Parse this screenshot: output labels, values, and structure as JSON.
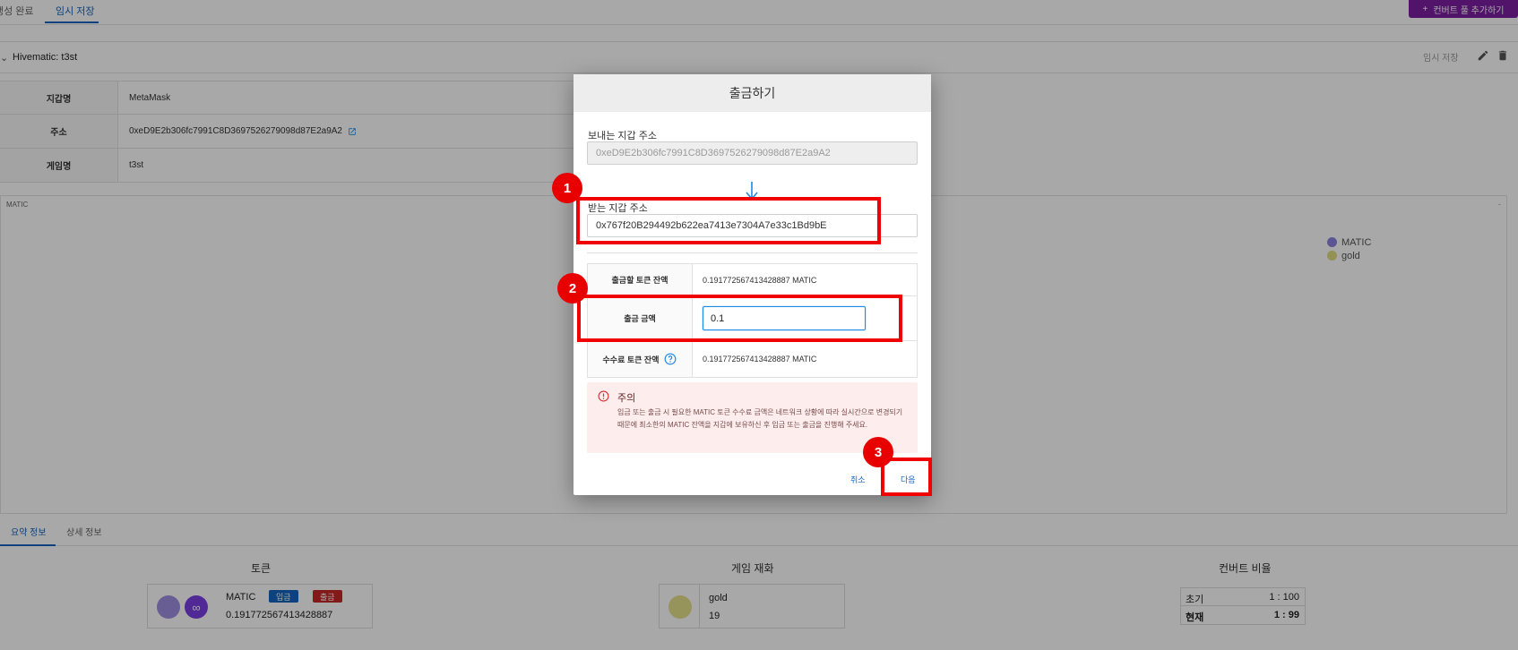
{
  "top_tabs": {
    "tab1": "생성 완료",
    "tab2": "임시 저장"
  },
  "add_pool_button": {
    "icon": "plus-icon",
    "label": "컨버트 풀 추가하기",
    "color": "#7b1fa2"
  },
  "section": {
    "title": "Hivematic: t3st",
    "temp_save": "임시 저장"
  },
  "info_rows": [
    {
      "label": "지갑명",
      "value": "MetaMask"
    },
    {
      "label": "주소",
      "value": "0xeD9E2b306fc7991C8D3697526279098d87E2a9A2"
    },
    {
      "label": "게임명",
      "value": "t3st"
    }
  ],
  "chart": {
    "label": "MATIC",
    "legend": [
      {
        "name": "MATIC",
        "color": "#8e80e0"
      },
      {
        "name": "gold",
        "color": "#e0dc80"
      }
    ]
  },
  "summary_tabs": {
    "tab1": "요약 정보",
    "tab2": "상세 정보"
  },
  "summary": {
    "token_head": "토큰",
    "asset_head": "게임 재화",
    "ratio_head": "컨버트 비율",
    "token": {
      "name": "MATIC",
      "deposit": "입금",
      "withdraw": "출금",
      "balance": "0.191772567413428887"
    },
    "asset": {
      "name": "gold",
      "value": "19"
    },
    "ratio": [
      {
        "label": "초기",
        "value": "1 : 100"
      },
      {
        "label": "현재",
        "value": "1 : 99"
      }
    ]
  },
  "dialog": {
    "title": "출금하기",
    "from_label": "보내는 지갑 주소",
    "from_address": "0xeD9E2b306fc7991C8D3697526279098d87E2a9A2",
    "to_label": "받는 지갑 주소",
    "to_address": "0x767f20B294492b622ea7413e7304A7e33c1Bd9bE",
    "rows": {
      "token_balance_label": "출금할 토큰 잔액",
      "token_balance_value": "0.191772567413428887 MATIC",
      "amount_label": "출금 금액",
      "amount_value": "0.1",
      "fee_label": "수수료 토큰 잔액",
      "fee_value": "0.191772567413428887 MATIC"
    },
    "warning": {
      "title": "주의",
      "text": "입금 또는 출금 시 필요한 MATIC 토큰 수수료 금액은 네트워크 상황에 따라 실시간으로 변경되기 때문에 최소한의 MATIC 잔액을 지갑에 보유하신 후 입금 또는 출금을 진행해 주세요."
    },
    "cancel": "취소",
    "next": "다음"
  },
  "annotations": [
    "1",
    "2",
    "3"
  ]
}
